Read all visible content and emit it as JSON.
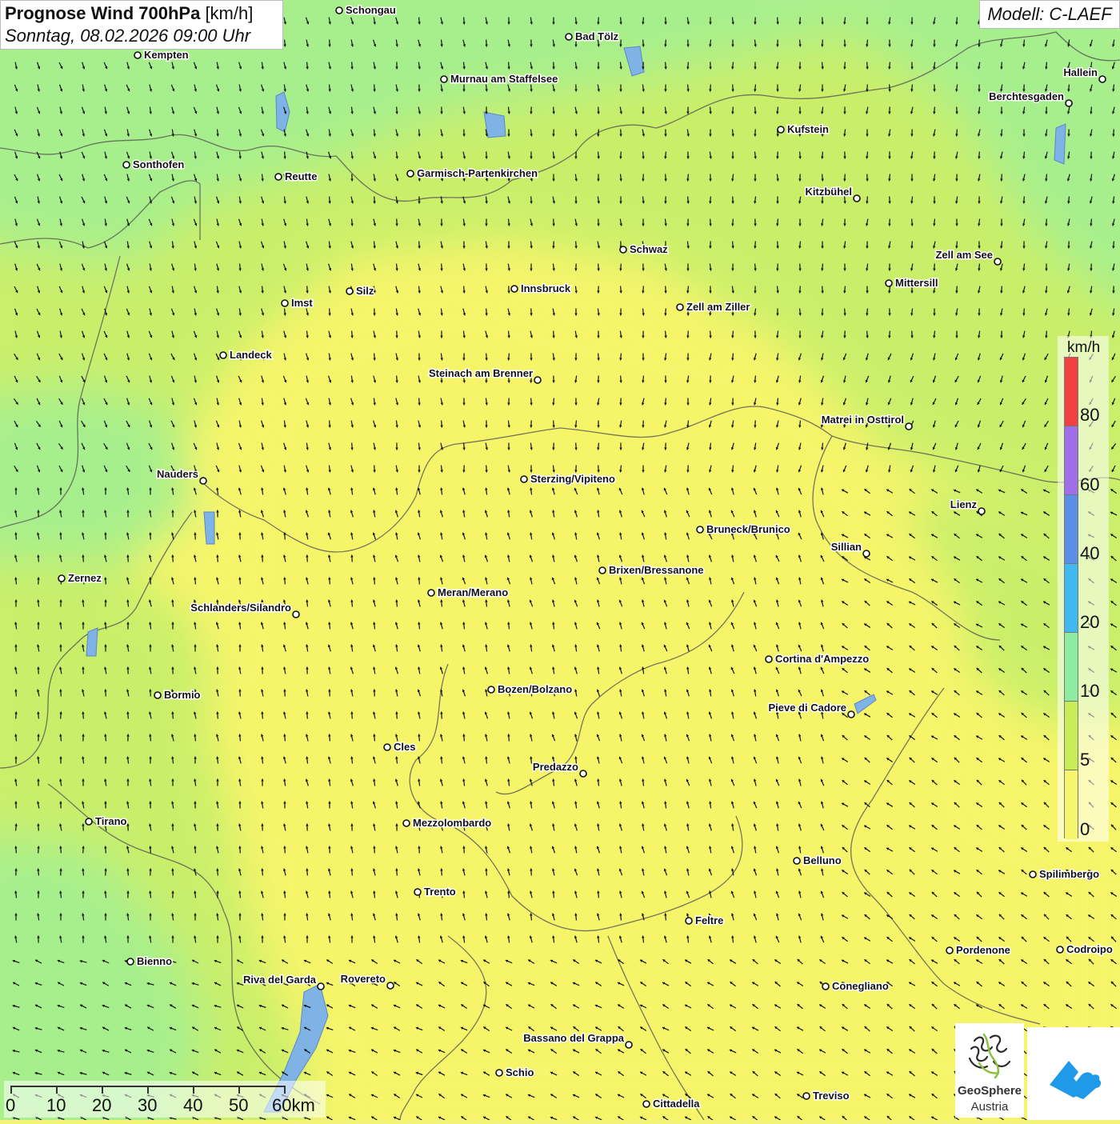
{
  "title": {
    "main": "Prognose Wind 700hPa",
    "unit": "[km/h]",
    "datetime": "Sonntag, 08.02.2026 09:00 Uhr"
  },
  "model_label": "Modell: C-LAEF",
  "legend": {
    "unit": "km/h",
    "ticks": [
      "80",
      "60",
      "40",
      "20",
      "10",
      "5",
      "0"
    ],
    "colors": [
      "#f04040",
      "#9f6fe8",
      "#5b8ee6",
      "#3fb9ef",
      "#8ceda0",
      "#c8ed57",
      "#f6f56b"
    ]
  },
  "scale_bar": {
    "labels": [
      "0",
      "10",
      "20",
      "30",
      "40",
      "50",
      "60km"
    ]
  },
  "logos": {
    "geosphere_name": "GeoSphere",
    "geosphere_sub": "Austria",
    "app_icon": "mountain-cloud-icon"
  },
  "wind_field": {
    "prevailing_direction": "northwest",
    "speed_zones_kmh": {
      "north": "10-20",
      "center": "0-5",
      "south": "5-10"
    }
  },
  "cities": [
    "Schongau",
    "Bad Tölz",
    "Kempten",
    "Murnau am Staffelsee",
    "Hallein",
    "Berchtesgaden",
    "Kufstein",
    "Sonthofen",
    "Reutte",
    "Garmisch-Partenkirchen",
    "Kitzbühel",
    "Schwaz",
    "Zell am See",
    "Mittersill",
    "Silz",
    "Innsbruck",
    "Imst",
    "Zell am Ziller",
    "Landeck",
    "Steinach am Brenner",
    "Matrei in Osttirol",
    "Nauders",
    "Sterzing/Vipiteno",
    "Lienz",
    "Bruneck/Brunico",
    "Sillian",
    "Brixen/Bressanone",
    "Zernez",
    "Meran/Merano",
    "Schlanders/Silandro",
    "Cortina d'Ampezzo",
    "Bozen/Bolzano",
    "Bormio",
    "Pieve di Cadore",
    "Cles",
    "Predazzo",
    "Tirano",
    "Mezzolombardo",
    "Belluno",
    "Spilimbergo",
    "Trento",
    "Feltre",
    "Bienno",
    "Pordenone",
    "Codroipo",
    "Riva del Garda",
    "Rovereto",
    "Conegliano",
    "Bassano del Grappa",
    "Schio",
    "Treviso",
    "Cittadella"
  ]
}
